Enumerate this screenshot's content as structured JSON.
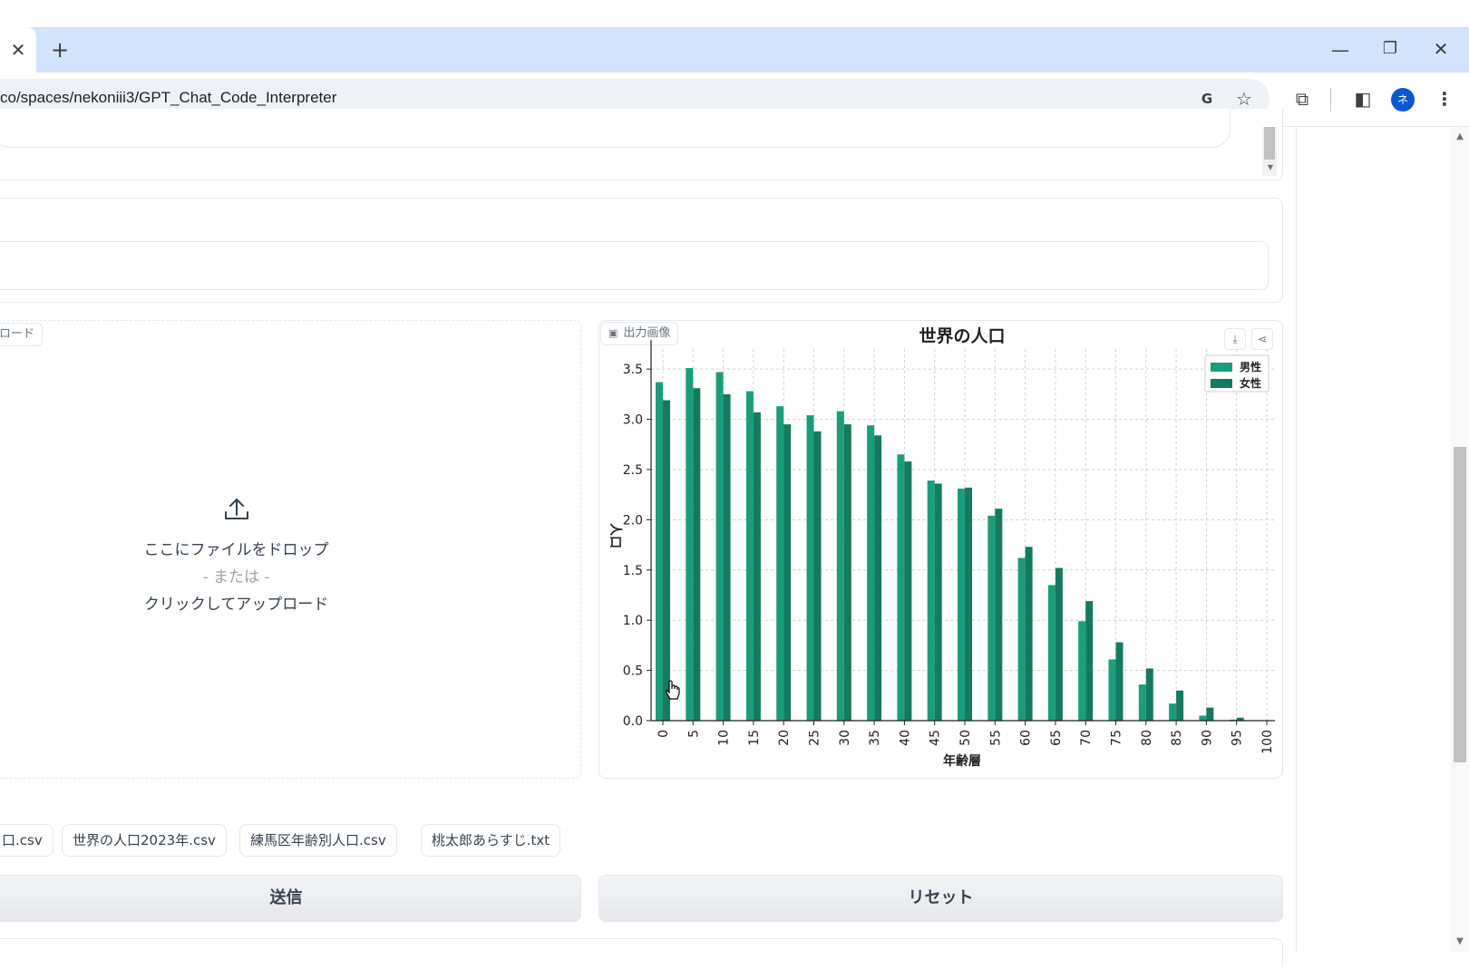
{
  "browser": {
    "url": "co/spaces/nekoniii3/GPT_Chat_Code_Interpreter",
    "profile_initial": "ネ"
  },
  "upload": {
    "label": "ロード",
    "drop_text": "ここにファイルをドロップ",
    "or_text": "- または -",
    "click_text": "クリックしてアップロード"
  },
  "output_image": {
    "label": "出力画像"
  },
  "examples": [
    "口.csv",
    "世界の人口2023年.csv",
    "練馬区年齢別人口.csv",
    "桃太郎あらすじ.txt"
  ],
  "buttons": {
    "submit": "送信",
    "reset": "リセット"
  },
  "chart_data": {
    "type": "bar",
    "title": "世界の人口",
    "xlabel": "年齢層",
    "ylabel": "人口",
    "categories": [
      "0",
      "5",
      "10",
      "15",
      "20",
      "25",
      "30",
      "35",
      "40",
      "45",
      "50",
      "55",
      "60",
      "65",
      "70",
      "75",
      "80",
      "85",
      "90",
      "95",
      "100"
    ],
    "series": [
      {
        "name": "男性",
        "color": "#1a9e7a",
        "values": [
          3.37,
          3.51,
          3.47,
          3.28,
          3.13,
          3.04,
          3.08,
          2.94,
          2.65,
          2.39,
          2.31,
          2.04,
          1.62,
          1.35,
          0.99,
          0.61,
          0.36,
          0.17,
          0.05,
          0.01,
          0.0
        ]
      },
      {
        "name": "女性",
        "color": "#157a5f",
        "values": [
          3.19,
          3.31,
          3.25,
          3.07,
          2.95,
          2.88,
          2.95,
          2.84,
          2.58,
          2.36,
          2.32,
          2.11,
          1.73,
          1.52,
          1.19,
          0.78,
          0.52,
          0.3,
          0.13,
          0.03,
          0.0
        ]
      }
    ],
    "yticks": [
      "0.0",
      "0.5",
      "1.0",
      "1.5",
      "2.0",
      "2.5",
      "3.0",
      "3.5"
    ],
    "ylim": [
      0,
      3.7
    ],
    "grid": true,
    "legend": "top-right"
  }
}
